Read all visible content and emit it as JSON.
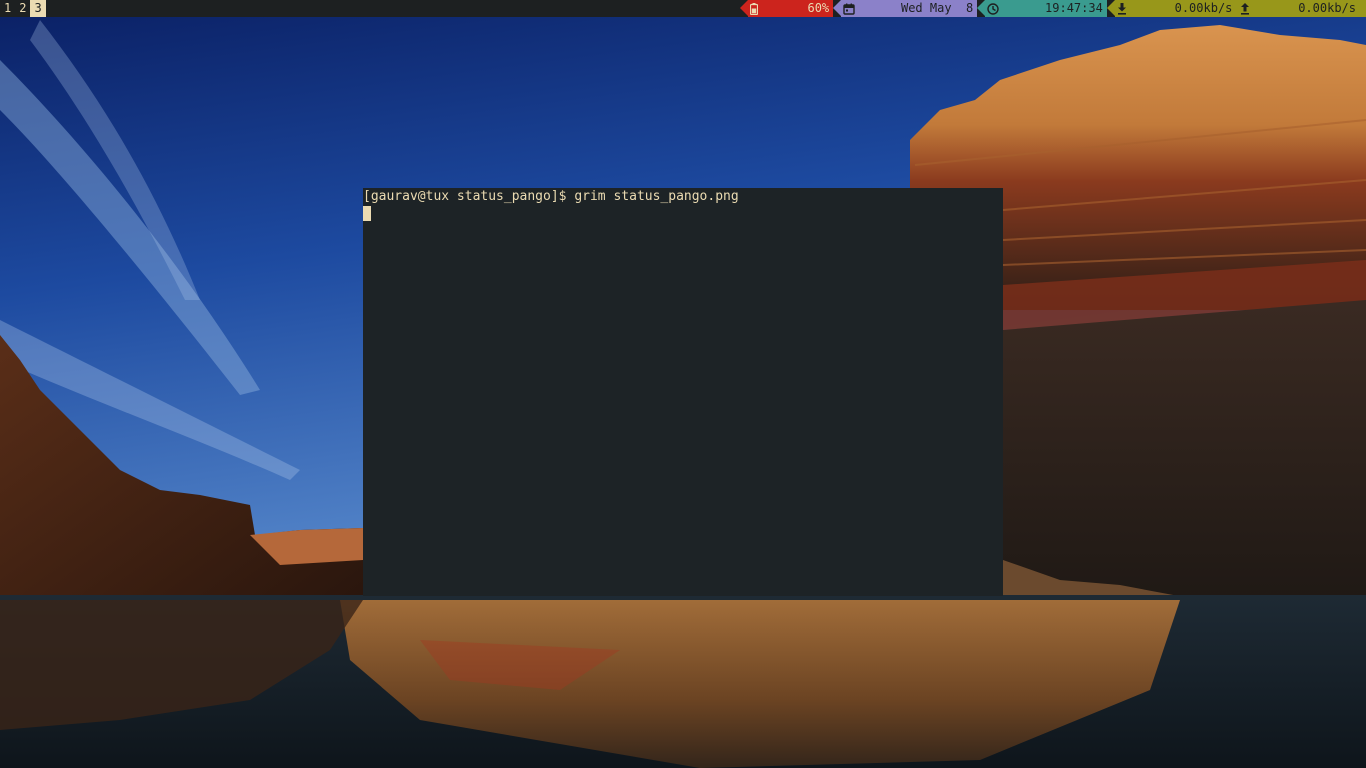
{
  "workspaces": [
    {
      "label": "1",
      "focused": false
    },
    {
      "label": "2",
      "focused": false
    },
    {
      "label": "3",
      "focused": true
    }
  ],
  "status_bar": {
    "battery": {
      "icon": "battery-icon",
      "value": "60%",
      "color": "#cc241d"
    },
    "date": {
      "icon": "calendar-icon",
      "value": "Wed May  8",
      "color": "#8b81c9"
    },
    "time": {
      "icon": "clock-icon",
      "value": "19:47:34",
      "color": "#3a9b8f"
    },
    "network": {
      "color": "#98971a",
      "download": {
        "icon": "download-icon",
        "value": "0.00kb/s"
      },
      "upload": {
        "icon": "upload-icon",
        "value": "0.00kb/s"
      }
    }
  },
  "terminal": {
    "prompt": "[gaurav@tux status_pango]$ ",
    "command": "grim status_pango.png"
  },
  "wallpaper": {
    "subject": "canyon cliffs reflected in river under blue sky"
  }
}
